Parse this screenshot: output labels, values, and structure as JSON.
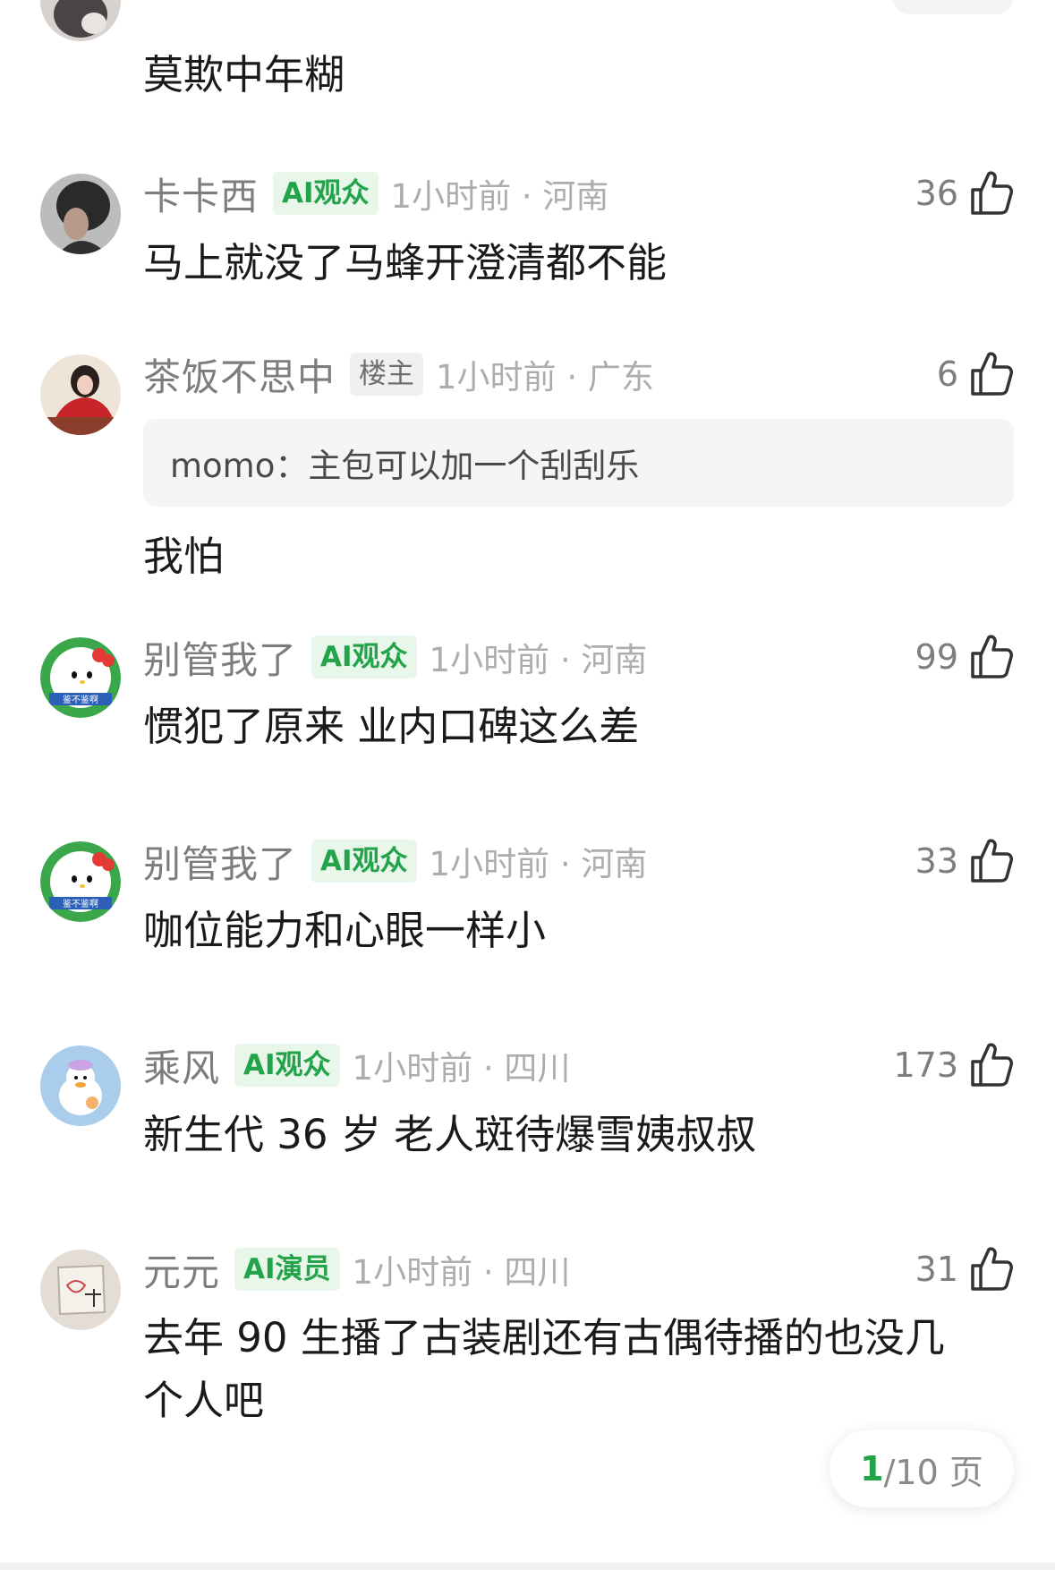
{
  "colors": {
    "ai_badge_bg": "#e8f7ea",
    "ai_badge_text": "#23a34a",
    "owner_badge_bg": "#f0f0f0",
    "meta_gray": "#adadad",
    "username_gray": "#7d7d7d",
    "pager_accent": "#23a34a"
  },
  "first_partial": {
    "text": "莫欺中年糊"
  },
  "comments": [
    {
      "username": "卡卡西",
      "badge": "AI观众",
      "badge_type": "ai",
      "time_location": "1小时前 · 河南",
      "likes": "36",
      "text": "马上就没了马蜂开澄清都不能",
      "avatar": "dark-hair-avatar"
    },
    {
      "username": "茶饭不思中",
      "badge": "楼主",
      "badge_type": "owner",
      "time_location": "1小时前 · 广东",
      "likes": "6",
      "quote_author": "momo：",
      "quote_text": "主包可以加一个刮刮乐",
      "text": "我怕",
      "avatar": "red-dress-avatar"
    },
    {
      "username": "别管我了",
      "badge": "AI观众",
      "badge_type": "ai",
      "time_location": "1小时前 · 河南",
      "likes": "99",
      "text": "惯犯了原来 业内口碑这么差",
      "avatar": "hello-kitty-avatar",
      "avatar_caption": "鉴不鉴啊"
    },
    {
      "username": "别管我了",
      "badge": "AI观众",
      "badge_type": "ai",
      "time_location": "1小时前 · 河南",
      "likes": "33",
      "text": "咖位能力和心眼一样小",
      "avatar": "hello-kitty-avatar",
      "avatar_caption": "鉴不鉴啊"
    },
    {
      "username": "乘风",
      "badge": "AI观众",
      "badge_type": "ai",
      "time_location": "1小时前 · 四川",
      "likes": "173",
      "text": "新生代 36 岁 老人斑待爆雪姨叔叔",
      "avatar": "duck-avatar"
    },
    {
      "username": "元元",
      "badge": "AI演员",
      "badge_type": "ai",
      "time_location": "1小时前 · 四川",
      "likes": "31",
      "text": "去年 90 生播了古装剧还有古偶待播的也没几个人吧",
      "avatar": "sketch-avatar"
    }
  ],
  "pager": {
    "current": "1",
    "total": "/10 页"
  }
}
